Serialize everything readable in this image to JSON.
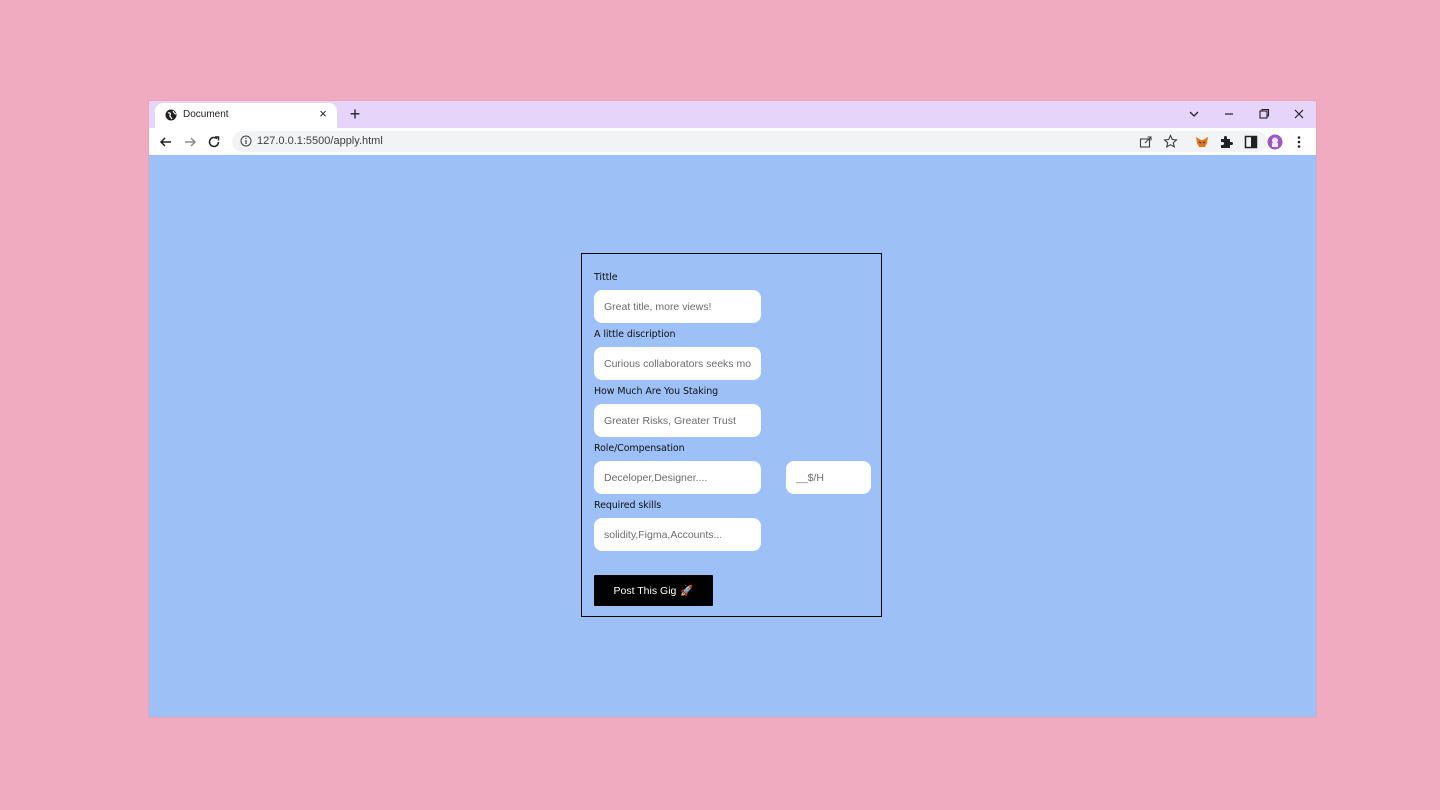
{
  "browser": {
    "tab_title": "Document",
    "tab_close": "×",
    "new_tab": "+",
    "url": "127.0.0.1:5500/apply.html"
  },
  "form": {
    "title_label": "Tittle",
    "title_placeholder": "Great title, more views!",
    "description_label": "A little discription",
    "description_placeholder": "Curious collaborators seeks more",
    "stake_label": "How Much Are You Staking",
    "stake_placeholder": "Greater Risks, Greater Trust",
    "role_label": "Role/Compensation",
    "role_placeholder": "Deceloper,Designer....",
    "rate_placeholder": "__$/H",
    "skills_label": "Required skills",
    "skills_placeholder": "solidity,Figma,Accounts...",
    "submit_label": "Post This Gig",
    "submit_emoji": "🚀"
  },
  "colors": {
    "page_background": "#9dc0f7",
    "outer_background": "#f0abc0",
    "tabstrip": "#e6d4fb",
    "button": "#000000"
  }
}
